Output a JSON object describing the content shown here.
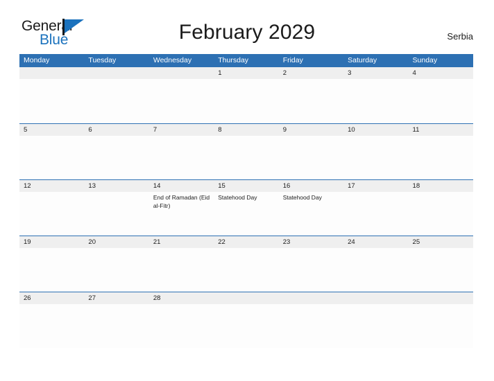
{
  "brand": {
    "name_part1": "General",
    "name_part2": "Blue",
    "mark_icon": "flag-triangle-icon"
  },
  "header": {
    "title": "February 2029",
    "country": "Serbia"
  },
  "calendar": {
    "weekdays": [
      "Monday",
      "Tuesday",
      "Wednesday",
      "Thursday",
      "Friday",
      "Saturday",
      "Sunday"
    ],
    "colors": {
      "header_blue": "#2d70b3",
      "day_band_gray": "#efefef",
      "cell_white": "#fdfdfd",
      "text": "#1b1b1b",
      "brand_blue": "#1b72bd"
    },
    "weeks": [
      [
        {
          "date": "",
          "events": []
        },
        {
          "date": "",
          "events": []
        },
        {
          "date": "",
          "events": []
        },
        {
          "date": "1",
          "events": []
        },
        {
          "date": "2",
          "events": []
        },
        {
          "date": "3",
          "events": []
        },
        {
          "date": "4",
          "events": []
        }
      ],
      [
        {
          "date": "5",
          "events": []
        },
        {
          "date": "6",
          "events": []
        },
        {
          "date": "7",
          "events": []
        },
        {
          "date": "8",
          "events": []
        },
        {
          "date": "9",
          "events": []
        },
        {
          "date": "10",
          "events": []
        },
        {
          "date": "11",
          "events": []
        }
      ],
      [
        {
          "date": "12",
          "events": []
        },
        {
          "date": "13",
          "events": []
        },
        {
          "date": "14",
          "events": [
            "End of Ramadan (Eid al-Fitr)"
          ]
        },
        {
          "date": "15",
          "events": [
            "Statehood Day"
          ]
        },
        {
          "date": "16",
          "events": [
            "Statehood Day"
          ]
        },
        {
          "date": "17",
          "events": []
        },
        {
          "date": "18",
          "events": []
        }
      ],
      [
        {
          "date": "19",
          "events": []
        },
        {
          "date": "20",
          "events": []
        },
        {
          "date": "21",
          "events": []
        },
        {
          "date": "22",
          "events": []
        },
        {
          "date": "23",
          "events": []
        },
        {
          "date": "24",
          "events": []
        },
        {
          "date": "25",
          "events": []
        }
      ],
      [
        {
          "date": "26",
          "events": []
        },
        {
          "date": "27",
          "events": []
        },
        {
          "date": "28",
          "events": []
        },
        {
          "date": "",
          "events": []
        },
        {
          "date": "",
          "events": []
        },
        {
          "date": "",
          "events": []
        },
        {
          "date": "",
          "events": []
        }
      ]
    ]
  }
}
